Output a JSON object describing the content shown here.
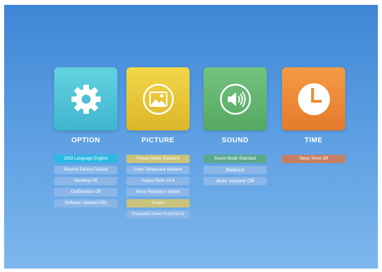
{
  "categories": [
    {
      "title": "OPTION",
      "icon": "gear-icon",
      "color": "#4fc6d8",
      "items": [
        "OSO Language English",
        "Restore Factory Default",
        "Blending Off",
        "OsdDuration Off",
        "Software Update(USB)"
      ]
    },
    {
      "title": "PICTURE",
      "icon": "picture-icon",
      "color": "#e9c63a",
      "items": [
        "Picture Mode Standard",
        "Color Temperatur Medium",
        "Aspect Ratio 16:9",
        "Noise Reduction Middle",
        "Screen",
        "Projection Direct Front On D"
      ]
    },
    {
      "title": "SOUND",
      "icon": "speaker-icon",
      "color": "#62b36e",
      "items": [
        "Sound Mode Standard",
        "Balance",
        "Auto Volume Off"
      ]
    },
    {
      "title": "TIME",
      "icon": "clock-icon",
      "color": "#ee8a36",
      "items": [
        "Sleep Timer Off"
      ]
    }
  ]
}
